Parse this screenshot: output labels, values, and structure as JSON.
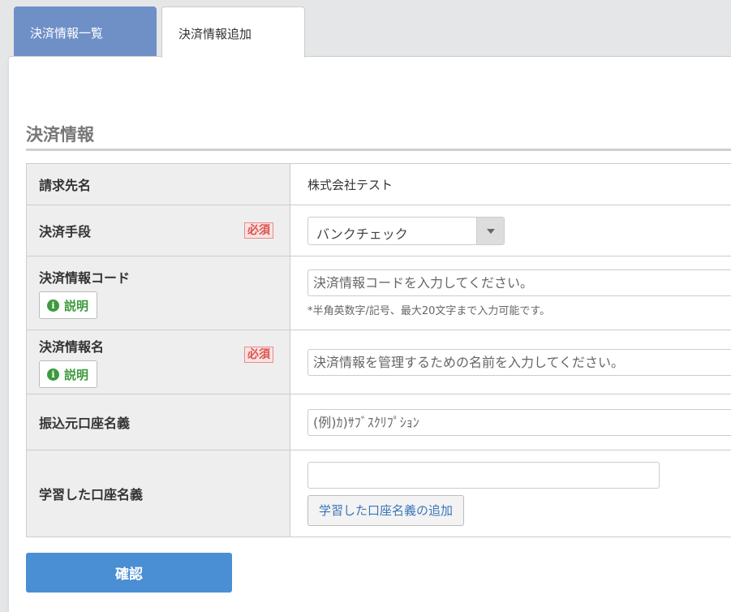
{
  "tabs": {
    "list_label": "決済情報一覧",
    "add_label": "決済情報追加"
  },
  "section": {
    "title": "決済情報"
  },
  "required_label": "必須",
  "help_label": "説明",
  "rows": {
    "billing_name": {
      "label": "請求先名",
      "value": "株式会社テスト"
    },
    "payment_method": {
      "label": "決済手段",
      "selected": "バンクチェック"
    },
    "payment_code": {
      "label": "決済情報コード",
      "placeholder": "決済情報コードを入力してください。",
      "hint": "*半角英数字/記号、最大20文字まで入力可能です。"
    },
    "payment_name": {
      "label": "決済情報名",
      "placeholder": "決済情報を管理するための名前を入力してください。"
    },
    "account_holder": {
      "label": "振込元口座名義",
      "placeholder": "(例)ｶ)ｻﾌﾞｽｸﾘﾌﾟｼｮﾝ"
    },
    "learned_account": {
      "label": "学習した口座名義",
      "value": "",
      "add_button": "学習した口座名義の追加"
    }
  },
  "confirm_button": "確認",
  "colors": {
    "active_tab": "#6f8fc7",
    "primary_button": "#4a8ed4",
    "required_badge": "#d9534f",
    "help_green": "#3c9a3c"
  }
}
